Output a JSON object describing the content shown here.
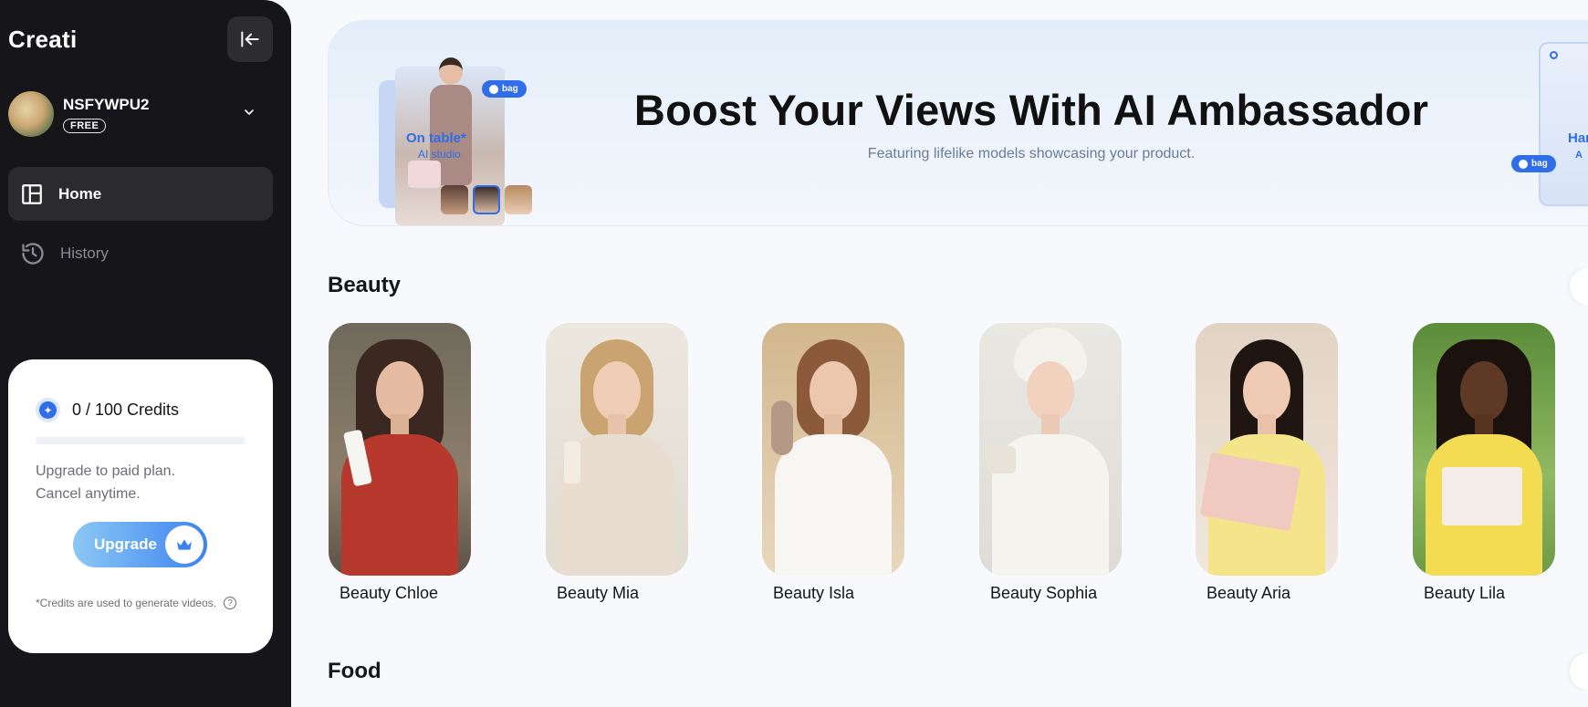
{
  "app": {
    "brand": "Creati"
  },
  "user": {
    "name": "NSFYWPU2",
    "plan": "FREE"
  },
  "nav": [
    {
      "label": "Home",
      "icon": "layout-icon",
      "active": true
    },
    {
      "label": "History",
      "icon": "history-icon",
      "active": false
    }
  ],
  "credits": {
    "label": "0 / 100 Credits",
    "progress_fraction": 0,
    "upgrade_text": "Upgrade to paid plan.\nCancel anytime.",
    "upgrade_button": "Upgrade",
    "note": "*Credits are used to generate videos.",
    "help_symbol": "?"
  },
  "banner": {
    "title": "Boost Your Views With AI Ambassador",
    "subtitle": "Featuring lifelike models showcasing your product.",
    "promo_tag": "bag",
    "promo_label": "On table*",
    "promo_sublabel": "AI studio",
    "right_tag": "bag",
    "right_label": "Han",
    "right_sublabel": "A"
  },
  "sections": [
    {
      "title": "Beauty",
      "items": [
        {
          "name": "Beauty Chloe"
        },
        {
          "name": "Beauty Mia"
        },
        {
          "name": "Beauty Isla"
        },
        {
          "name": "Beauty Sophia"
        },
        {
          "name": "Beauty Aria"
        },
        {
          "name": "Beauty Lila"
        }
      ]
    },
    {
      "title": "Food",
      "items": []
    }
  ],
  "colors": {
    "sidebar_bg": "#16161a",
    "accent": "#2f6ee8",
    "page_bg": "#f7f9fc"
  }
}
